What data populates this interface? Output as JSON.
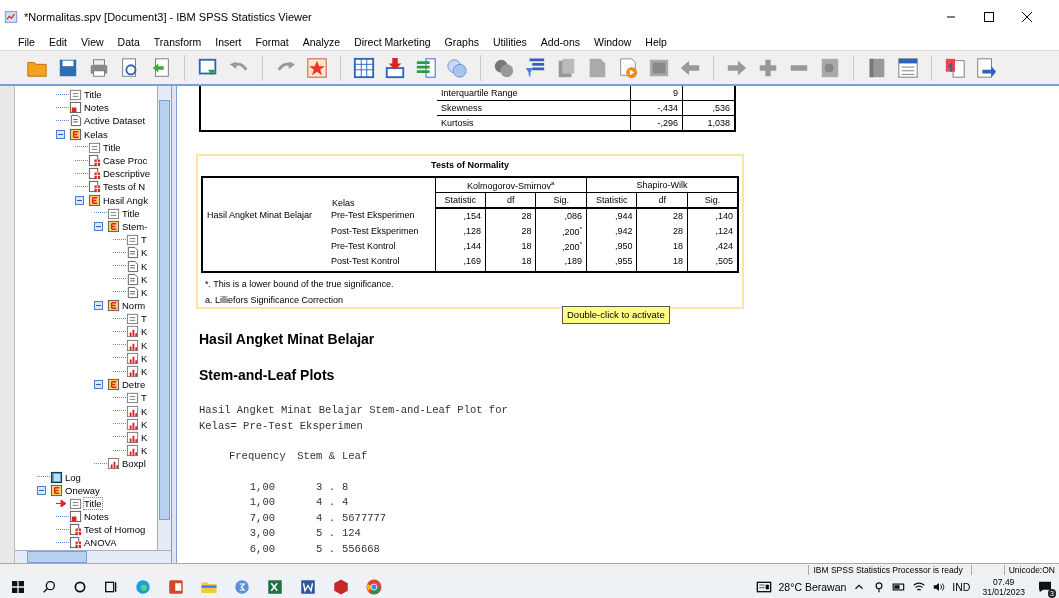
{
  "window": {
    "title": "*Normalitas.spv [Document3] - IBM SPSS Statistics Viewer"
  },
  "menu": [
    "File",
    "Edit",
    "View",
    "Data",
    "Transform",
    "Insert",
    "Format",
    "Analyze",
    "Direct Marketing",
    "Graphs",
    "Utilities",
    "Add-ons",
    "Window",
    "Help"
  ],
  "tree": {
    "continued_items": [
      {
        "label": "Title",
        "kind": "title",
        "selected": false
      },
      {
        "label": "Notes",
        "kind": "notes",
        "selected": false
      },
      {
        "label": "Active Dataset",
        "kind": "text",
        "selected": false
      },
      {
        "label": "Kelas",
        "kind": "heading",
        "selected": false,
        "expanded": true,
        "children": [
          {
            "label": "Title",
            "kind": "title",
            "selected": false
          },
          {
            "label": "Case Proc",
            "kind": "table",
            "selected": false
          },
          {
            "label": "Descriptive",
            "kind": "table",
            "selected": false
          },
          {
            "label": "Tests of N",
            "kind": "table",
            "selected": false
          },
          {
            "label": "Hasil Angk",
            "kind": "heading",
            "selected": false,
            "expanded": true,
            "children": [
              {
                "label": "Title",
                "kind": "title",
                "selected": false
              },
              {
                "label": "Stem-",
                "kind": "heading",
                "selected": false,
                "expanded": true,
                "children": [
                  {
                    "label": "T",
                    "kind": "title",
                    "selected": false
                  },
                  {
                    "label": "K",
                    "kind": "text",
                    "selected": false
                  },
                  {
                    "label": "K",
                    "kind": "text",
                    "selected": false
                  },
                  {
                    "label": "K",
                    "kind": "text",
                    "selected": false
                  },
                  {
                    "label": "K",
                    "kind": "text",
                    "selected": false
                  }
                ]
              },
              {
                "label": "Norm",
                "kind": "heading",
                "selected": false,
                "expanded": true,
                "children": [
                  {
                    "label": "T",
                    "kind": "title",
                    "selected": false
                  },
                  {
                    "label": "K",
                    "kind": "chart",
                    "selected": false
                  },
                  {
                    "label": "K",
                    "kind": "chart",
                    "selected": false
                  },
                  {
                    "label": "K",
                    "kind": "chart",
                    "selected": false
                  },
                  {
                    "label": "K",
                    "kind": "chart",
                    "selected": false
                  }
                ]
              },
              {
                "label": "Detre",
                "kind": "heading",
                "selected": false,
                "expanded": true,
                "children": [
                  {
                    "label": "T",
                    "kind": "title",
                    "selected": false
                  },
                  {
                    "label": "K",
                    "kind": "chart",
                    "selected": false
                  },
                  {
                    "label": "K",
                    "kind": "chart",
                    "selected": false
                  },
                  {
                    "label": "K",
                    "kind": "chart",
                    "selected": false
                  },
                  {
                    "label": "K",
                    "kind": "chart",
                    "selected": false
                  }
                ]
              },
              {
                "label": "Boxpl",
                "kind": "chart",
                "selected": false
              }
            ]
          }
        ]
      }
    ],
    "items": [
      {
        "label": "Log",
        "kind": "log",
        "selected": false
      },
      {
        "label": "Oneway",
        "kind": "heading",
        "selected": false,
        "expanded": true,
        "children": [
          {
            "label": "Title",
            "kind": "title",
            "selected": true
          },
          {
            "label": "Notes",
            "kind": "notes",
            "selected": false
          },
          {
            "label": "Test of Homog",
            "kind": "table",
            "selected": false
          },
          {
            "label": "ANOVA",
            "kind": "table",
            "selected": false
          }
        ]
      }
    ]
  },
  "descriptives": {
    "rows": [
      {
        "label": "Interquartile Range",
        "values": [
          "9"
        ]
      },
      {
        "label": "Skewness",
        "values": [
          "-,434",
          ",536"
        ]
      },
      {
        "label": "Kurtosis",
        "values": [
          "-,296",
          "1,038"
        ]
      }
    ]
  },
  "tests_of_normality": {
    "title": "Tests of Normality",
    "group_headers": [
      "Kolmogorov-Smirnov$^{a}$",
      "Shapiro-Wilk"
    ],
    "row_header": "Kelas",
    "columns": [
      "Statistic",
      "df",
      "Sig.",
      "Statistic",
      "df",
      "Sig."
    ],
    "variable": "Hasil Angket Minat Belajar",
    "rows": [
      {
        "group": "Pre-Test Eksperimen",
        "values": [
          ",154",
          "28",
          ",086",
          ",944",
          "28",
          ",140"
        ]
      },
      {
        "group": "Post-Test Eksperimen",
        "values": [
          ",128",
          "28",
          ",200$^{*}$",
          ",942",
          "28",
          ",124"
        ]
      },
      {
        "group": "Pre-Test Kontrol",
        "values": [
          ",144",
          "18",
          ",200$^{*}$",
          ",950",
          "18",
          ",424"
        ]
      },
      {
        "group": "Post-Test Kontrol",
        "values": [
          ",169",
          "18",
          ",189",
          ",955",
          "18",
          ",505"
        ]
      }
    ],
    "footnotes": [
      "*. This is a lower bound of the true significance.",
      "a. Lilliefors Significance Correction"
    ]
  },
  "tooltip": "Double-click to activate",
  "headings": [
    "Hasil Angket Minat Belajar",
    "Stem-and-Leaf Plots"
  ],
  "stem_leaf": {
    "title_lines": [
      "Hasil Angket Minat Belajar Stem-and-Leaf Plot for",
      "Kelas= Pre-Test Eksperimen"
    ],
    "header": {
      "frequency": "Frequency",
      "stem": "Stem &",
      "leaf": "Leaf"
    },
    "rows": [
      {
        "frequency": "1,00",
        "stem": "3 .",
        "leaf": "8"
      },
      {
        "frequency": "1,00",
        "stem": "4 .",
        "leaf": "4"
      },
      {
        "frequency": "7,00",
        "stem": "4 .",
        "leaf": "5677777"
      },
      {
        "frequency": "3,00",
        "stem": "5 .",
        "leaf": "124"
      },
      {
        "frequency": "6,00",
        "stem": "5 .",
        "leaf": "556668"
      }
    ]
  },
  "status_bar": {
    "message": "IBM SPSS Statistics Processor is ready",
    "encoding": "Unicode:ON"
  },
  "taskbar": {
    "weather": "28°C Berawan",
    "language": "IND",
    "time": "07.49",
    "date": "31/01/2023",
    "notifications": "3"
  }
}
